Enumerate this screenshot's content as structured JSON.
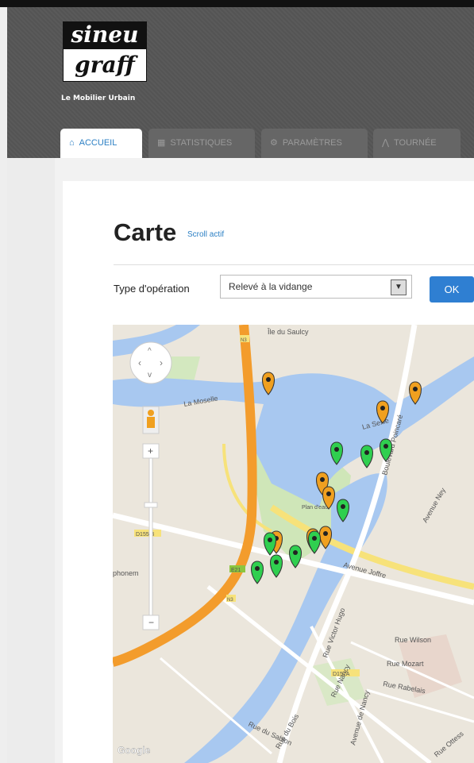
{
  "brand": {
    "logo_line1": "sineu",
    "logo_line2": "graff",
    "tagline": "Le Mobilier Urbain"
  },
  "tabs": [
    {
      "label": "ACCUEIL",
      "icon": "home-icon",
      "active": true
    },
    {
      "label": "STATISTIQUES",
      "icon": "stats-icon",
      "active": false
    },
    {
      "label": "PARAMÈTRES",
      "icon": "gear-icon",
      "active": false
    },
    {
      "label": "TOURNÉE",
      "icon": "route-icon",
      "active": false
    }
  ],
  "page": {
    "title": "Carte",
    "scroll_link": "Scroll actif"
  },
  "filter": {
    "label": "Type d'opération",
    "selected": "Relevé à la vidange",
    "ok_label": "OK"
  },
  "map": {
    "labels": {
      "island": "Île du Saulcy",
      "river": "La Moselle",
      "river2": "La Seille",
      "boulevard": "Boulevard Poincaré",
      "avenue": "Avenue Joffre",
      "street": "Avenue Ney",
      "quai": "Rue Wilson",
      "rue2": "Rue Mozart",
      "rue3": "Rue Rabelais",
      "rue4": "Rue du Sablon",
      "rue5": "Avenue de Nancy",
      "road": "D157A",
      "road2": "D155 B",
      "road3": "E21",
      "road4": "N3",
      "road5": "N3",
      "bridge": "Plan d'eau",
      "left": "phonem",
      "rue6": "Rue du Bois",
      "rue7": "Rue Nancy",
      "rue8": "Rue Ottess",
      "victor": "Rue Victor Hugo",
      "google": "Google"
    },
    "markers": {
      "orange": 8,
      "green": 9
    },
    "colors": {
      "orange": "#f0a020",
      "green": "#2fcf4f",
      "water": "#a8c8f0",
      "road": "#f39c2c"
    }
  }
}
